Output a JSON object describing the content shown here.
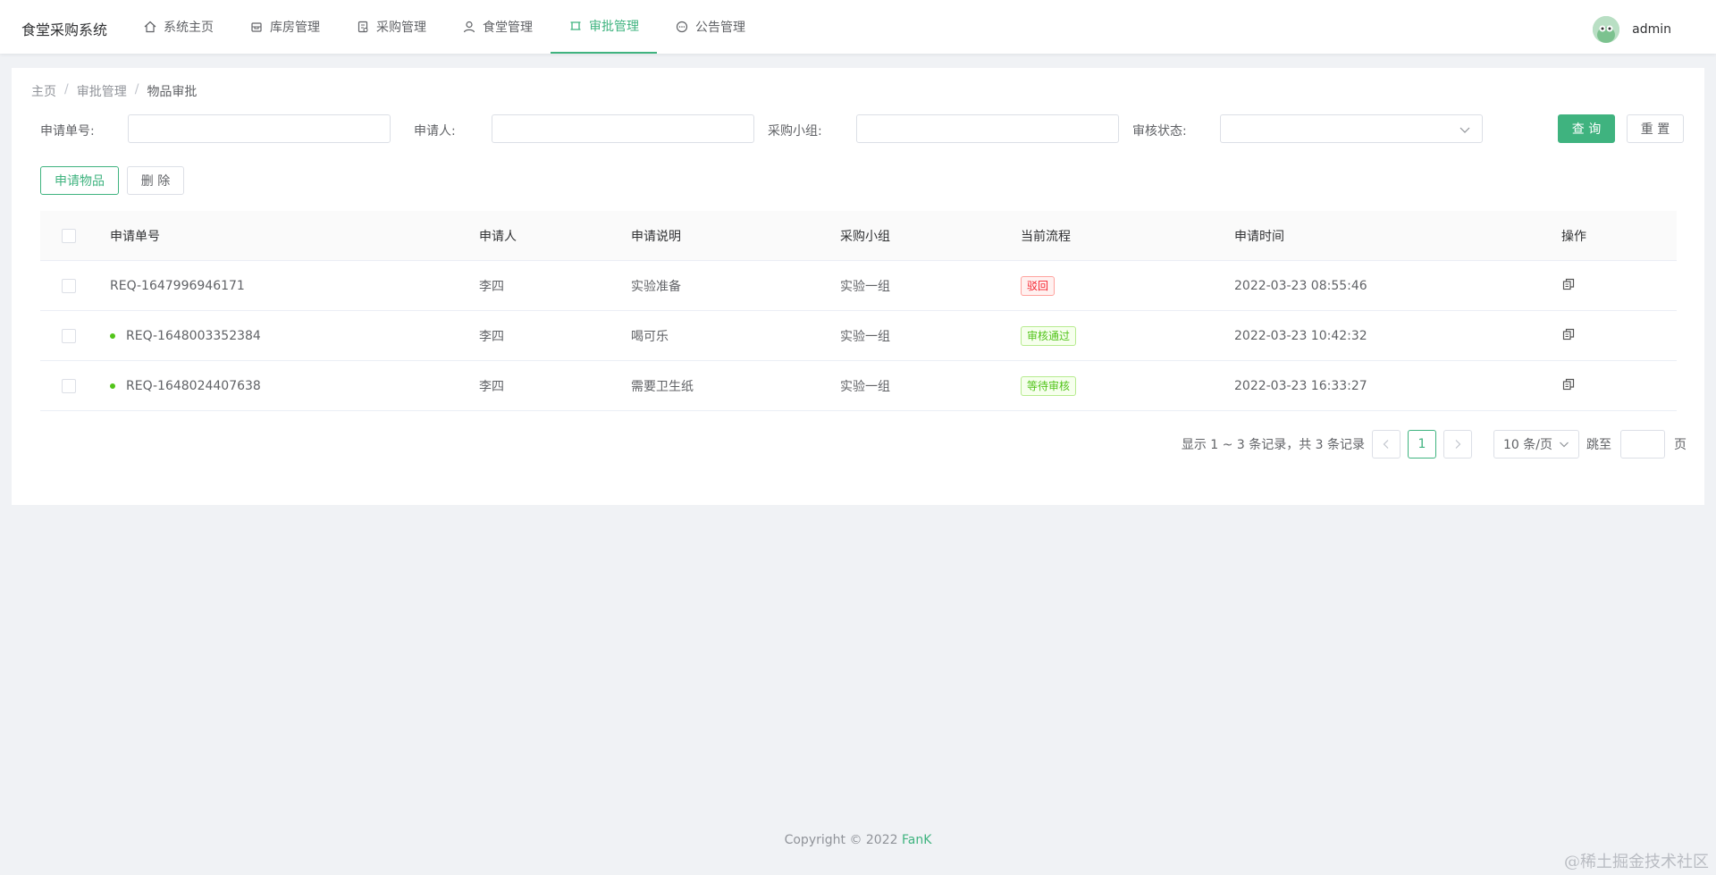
{
  "app": {
    "brand": "食堂采购系统"
  },
  "nav": [
    {
      "label": "系统主页",
      "icon": "home-icon"
    },
    {
      "label": "库房管理",
      "icon": "box-icon"
    },
    {
      "label": "采购管理",
      "icon": "document-icon"
    },
    {
      "label": "食堂管理",
      "icon": "user-icon"
    },
    {
      "label": "审批管理",
      "icon": "approve-icon",
      "active": true
    },
    {
      "label": "公告管理",
      "icon": "chat-icon"
    }
  ],
  "user": {
    "name": "admin"
  },
  "breadcrumb": [
    "主页",
    "审批管理",
    "物品审批"
  ],
  "filters": {
    "req_no_label": "申请单号:",
    "applicant_label": "申请人:",
    "group_label": "采购小组:",
    "status_label": "审核状态:",
    "query_btn": "查 询",
    "reset_btn": "重 置"
  },
  "actions": {
    "apply_btn": "申请物品",
    "delete_btn": "删 除"
  },
  "table": {
    "headers": [
      "申请单号",
      "申请人",
      "申请说明",
      "采购小组",
      "当前流程",
      "申请时间",
      "操作"
    ],
    "rows": [
      {
        "dot": false,
        "req_no": "REQ-1647996946171",
        "applicant": "李四",
        "desc": "实验准备",
        "group": "实验一组",
        "status": "驳回",
        "status_type": "red",
        "time": "2022-03-23 08:55:46"
      },
      {
        "dot": true,
        "req_no": "REQ-1648003352384",
        "applicant": "李四",
        "desc": "喝可乐",
        "group": "实验一组",
        "status": "审核通过",
        "status_type": "green",
        "time": "2022-03-23 10:42:32"
      },
      {
        "dot": true,
        "req_no": "REQ-1648024407638",
        "applicant": "李四",
        "desc": "需要卫生纸",
        "group": "实验一组",
        "status": "等待审核",
        "status_type": "green",
        "time": "2022-03-23 16:33:27"
      }
    ]
  },
  "pagination": {
    "summary": "显示 1 ~ 3 条记录，共 3 条记录",
    "current_page": "1",
    "page_size": "10 条/页",
    "jump_prefix": "跳至",
    "jump_suffix": "页"
  },
  "footer": {
    "copyright": "Copyright © 2022 ",
    "author": "FanK"
  },
  "watermark": "@稀土掘金技术社区",
  "colors": {
    "accent": "#3fb37f",
    "reject": "#f5222d",
    "pass": "#52c41a"
  }
}
